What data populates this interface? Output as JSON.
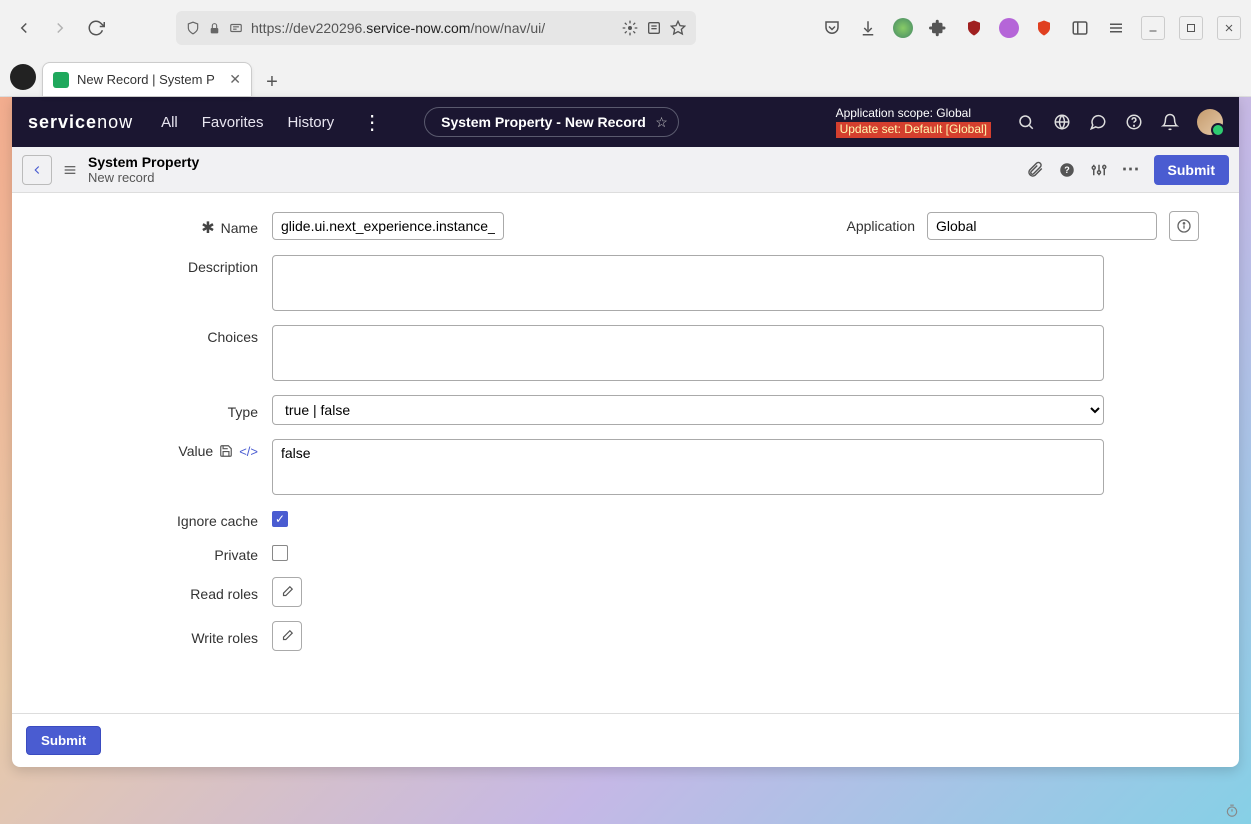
{
  "browser": {
    "url_prefix": "https://dev220296.",
    "url_domain": "service-now.com",
    "url_suffix": "/now/nav/ui/",
    "tab_title": "New Record | System P"
  },
  "top_nav": {
    "logo_a": "service",
    "logo_b": "now",
    "links": [
      "All",
      "Favorites",
      "History"
    ],
    "pill_text": "System Property - New Record",
    "scope_line1": "Application scope: Global",
    "scope_line2": "Update set: Default [Global]"
  },
  "form_header": {
    "title": "System Property",
    "subtitle": "New record",
    "submit_label": "Submit"
  },
  "form": {
    "labels": {
      "name": "Name",
      "application": "Application",
      "description": "Description",
      "choices": "Choices",
      "type": "Type",
      "value": "Value",
      "ignore_cache": "Ignore cache",
      "private": "Private",
      "read_roles": "Read roles",
      "write_roles": "Write roles"
    },
    "values": {
      "name": "glide.ui.next_experience.instance_to",
      "application": "Global",
      "description": "",
      "choices": "",
      "type_selected": "true | false",
      "value": "false",
      "ignore_cache": true,
      "private": false
    }
  },
  "bottom": {
    "submit_label": "Submit"
  }
}
